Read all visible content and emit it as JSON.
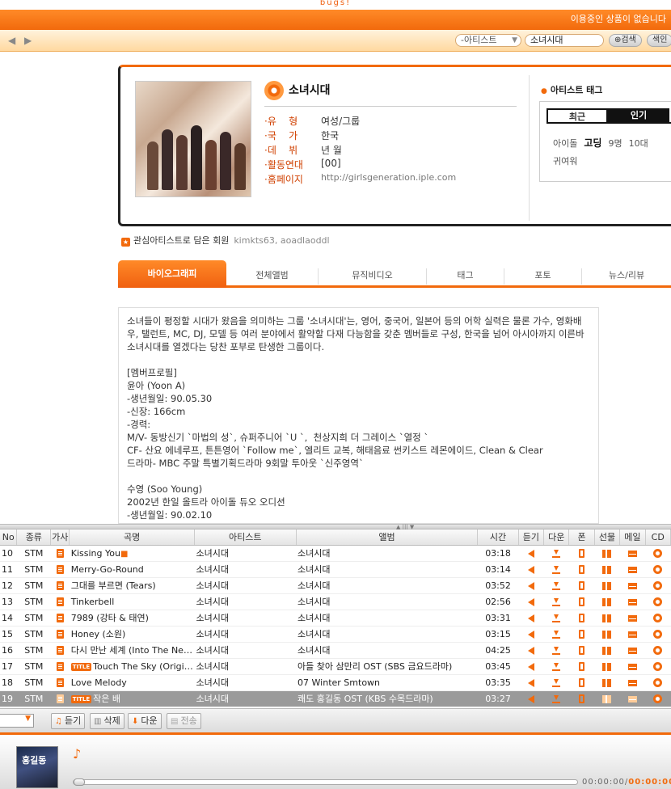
{
  "header": {
    "logo_text": "bugs!",
    "notice": "이용중인 상품이 없습니다",
    "search_type": "-아티스트",
    "search_value": "소녀시대",
    "search_button": "검색",
    "index_button": "색인"
  },
  "artist": {
    "name": "소녀시대",
    "info": [
      {
        "key": "·유    형",
        "value": "여성/그룹"
      },
      {
        "key": "·국    가",
        "value": "한국"
      },
      {
        "key": "·데    뷔",
        "value": "년 월"
      },
      {
        "key": "·활동연대",
        "value": "[00]"
      },
      {
        "key": "·홈페이지",
        "value": "http://girlsgeneration.iple.com"
      }
    ],
    "tag_title": "아티스트 태그",
    "tag_tabs": [
      "최근",
      "인기"
    ],
    "tags": [
      "아이돌",
      "고딩",
      "9명",
      "10대",
      "귀여워"
    ],
    "fav_label": "관심아티스트로 담은 회원",
    "fav_members": "kimkts63, aoadlaoddl"
  },
  "tabs": [
    "바이오그래피",
    "전체앨범",
    "뮤직비디오",
    "태그",
    "포토",
    "뉴스/리뷰"
  ],
  "bio": "소녀들이 평정할 시대가 왔음을 의미하는 그룹 '소녀시대'는, 영어, 중국어, 일본어 등의 어학 실력은 물론 가수, 영화배우, 탤런트, MC, DJ, 모델 등 여러 분야에서 활약할 다재 다능함을 갖춘 멤버들로 구성, 한국을 넘어 아시아까지 이른바 소녀시대를 열겠다는 당찬 포부로 탄생한 그룹이다.\n\n[멤버프로필]\n윤아 (Yoon A)\n-생년월일: 90.05.30\n-신장: 166cm\n-경력:\nM/V- 동방신기 `마법의 성`, 슈퍼주니어 `U `,  천상지희 더 그레이스 `열정 `\nCF- 산요 에네루프, 튼튼영어 `Follow me`, 엘리트 교복, 해태음료 썬키스트 레몬에이드, Clean & Clear\n드라마- MBC 주말 특별기획드라마 9회말 투아웃 `신주영역`\n\n수영 (Soo Young)\n2002년 한일 올트라 아이돌 듀오 오디션\n-생년월일: 90.02.10",
  "playlist": {
    "headers": [
      "No",
      "종류",
      "가사",
      "곡명",
      "아티스트",
      "앨범",
      "시간",
      "듣기",
      "다운",
      "폰",
      "선물",
      "메일",
      "CD"
    ],
    "rows": [
      {
        "no": "10",
        "type": "STM",
        "title": "Kissing You",
        "badge": "",
        "mv": true,
        "artist": "소녀시대",
        "album": "소녀시대",
        "time": "03:18"
      },
      {
        "no": "11",
        "type": "STM",
        "title": "Merry-Go-Round",
        "badge": "",
        "mv": false,
        "artist": "소녀시대",
        "album": "소녀시대",
        "time": "03:14"
      },
      {
        "no": "12",
        "type": "STM",
        "title": "그대를 부르면 (Tears)",
        "badge": "",
        "mv": false,
        "artist": "소녀시대",
        "album": "소녀시대",
        "time": "03:52"
      },
      {
        "no": "13",
        "type": "STM",
        "title": "Tinkerbell",
        "badge": "",
        "mv": false,
        "artist": "소녀시대",
        "album": "소녀시대",
        "time": "02:56"
      },
      {
        "no": "14",
        "type": "STM",
        "title": "7989 (강타 & 태연)",
        "badge": "",
        "mv": false,
        "artist": "소녀시대",
        "album": "소녀시대",
        "time": "03:31"
      },
      {
        "no": "15",
        "type": "STM",
        "title": "Honey (소원)",
        "badge": "",
        "mv": false,
        "artist": "소녀시대",
        "album": "소녀시대",
        "time": "03:15"
      },
      {
        "no": "16",
        "type": "STM",
        "title": "다시 만난 세계 (Into The New World)",
        "badge": "",
        "mv": false,
        "artist": "소녀시대",
        "album": "소녀시대",
        "time": "04:25"
      },
      {
        "no": "17",
        "type": "STM",
        "title": "Touch The Sky (Original)",
        "badge": "TITLE",
        "mv": false,
        "artist": "소녀시대",
        "album": "아들 찾아 삼만리 OST (SBS 금요드라마)",
        "time": "03:45"
      },
      {
        "no": "18",
        "type": "STM",
        "title": "Love Melody",
        "badge": "",
        "mv": false,
        "artist": "소녀시대",
        "album": "07 Winter Smtown",
        "time": "03:35"
      },
      {
        "no": "19",
        "type": "STM",
        "title": "작은 배",
        "badge": "TITLE",
        "mv": false,
        "artist": "소녀시대",
        "album": "쾌도 홍길동 OST (KBS 수목드라마)",
        "time": "03:27",
        "selected": true
      }
    ]
  },
  "toolbar": {
    "listen": "듣기",
    "delete": "삭제",
    "download": "다운",
    "send": "전송"
  },
  "player": {
    "album_label": "홍길동",
    "elapsed": "00:00:00",
    "total": "00:00:00",
    "progress": 0
  },
  "colors": {
    "accent": "#f26a0c",
    "selected_row": "#9a9a9a"
  }
}
